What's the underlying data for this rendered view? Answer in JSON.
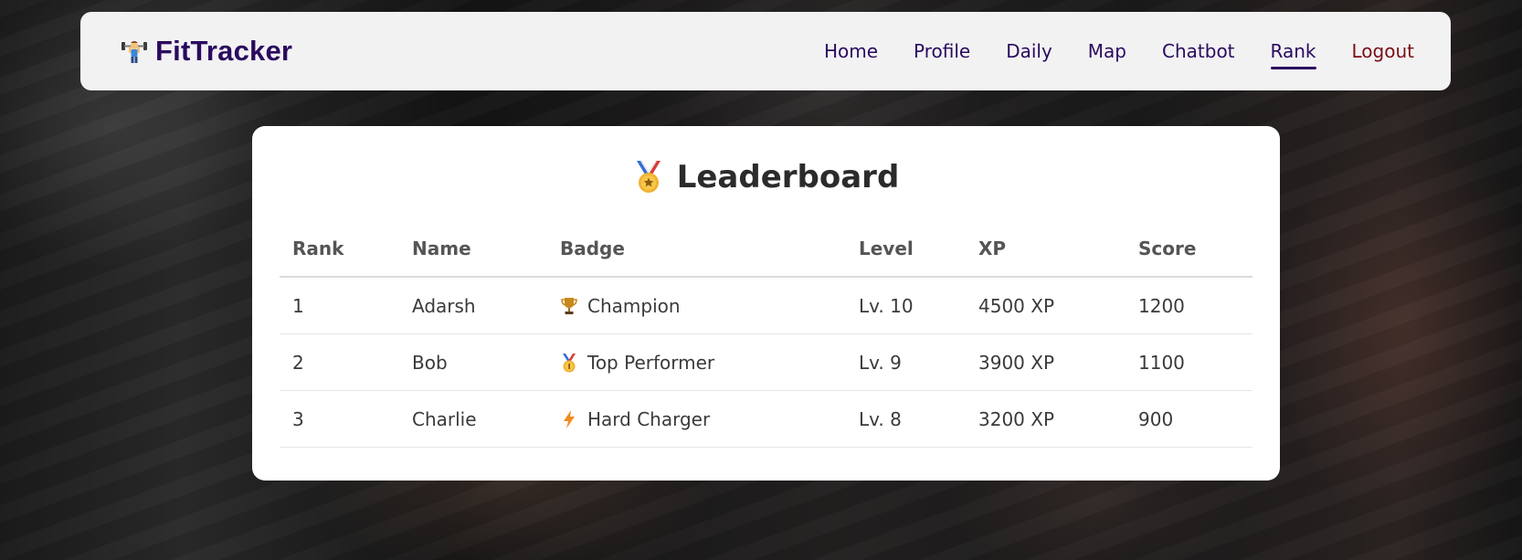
{
  "app": {
    "brand_name": "FitTracker",
    "brand_icon": "weightlifter-icon"
  },
  "nav": {
    "items": [
      {
        "label": "Home",
        "active": false
      },
      {
        "label": "Profile",
        "active": false
      },
      {
        "label": "Daily",
        "active": false
      },
      {
        "label": "Map",
        "active": false
      },
      {
        "label": "Chatbot",
        "active": false
      },
      {
        "label": "Rank",
        "active": true
      },
      {
        "label": "Logout",
        "active": false
      }
    ]
  },
  "leaderboard": {
    "title": "Leaderboard",
    "title_icon": "medal-icon",
    "columns": [
      "Rank",
      "Name",
      "Badge",
      "Level",
      "XP",
      "Score"
    ],
    "rows": [
      {
        "rank": "1",
        "name": "Adarsh",
        "badge_icon": "trophy-icon",
        "badge": "Champion",
        "level": "Lv. 10",
        "xp": "4500 XP",
        "score": "1200"
      },
      {
        "rank": "2",
        "name": "Bob",
        "badge_icon": "first-place-medal-icon",
        "badge": "Top Performer",
        "level": "Lv. 9",
        "xp": "3900 XP",
        "score": "1100"
      },
      {
        "rank": "3",
        "name": "Charlie",
        "badge_icon": "lightning-icon",
        "badge": "Hard Charger",
        "level": "Lv. 8",
        "xp": "3200 XP",
        "score": "900"
      }
    ]
  },
  "colors": {
    "brand": "#2a0a5e",
    "logout": "#7a0e16",
    "card_bg": "#ffffff",
    "navbar_bg": "#f2f2f3"
  }
}
